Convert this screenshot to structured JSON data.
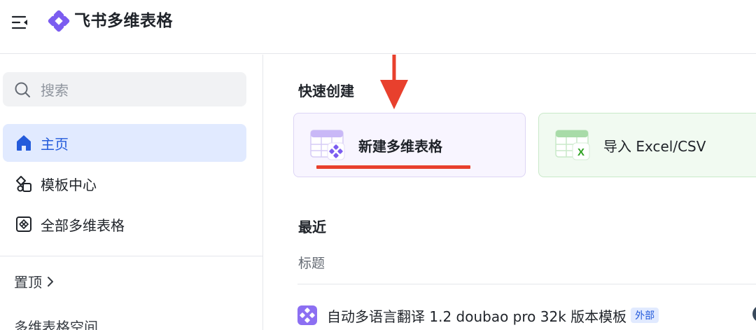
{
  "header": {
    "app_title": "飞书多维表格",
    "collapse_icon": "sidebar-collapse-icon",
    "logo_icon": "bitable-logo-icon",
    "brand_color": "#7b5cf0"
  },
  "sidebar": {
    "search_placeholder": "搜索",
    "items": [
      {
        "label": "主页",
        "icon": "home-icon",
        "active": true
      },
      {
        "label": "模板中心",
        "icon": "template-icon",
        "active": false
      },
      {
        "label": "全部多维表格",
        "icon": "all-bitable-icon",
        "active": false
      }
    ],
    "pinned_label": "置顶",
    "space_label": "多维表格空间"
  },
  "main": {
    "quick_create_title": "快速创建",
    "cards": [
      {
        "label": "新建多维表格",
        "icon": "new-bitable-icon"
      },
      {
        "label": "导入 Excel/CSV",
        "icon": "import-excel-icon"
      }
    ],
    "recent_title": "最近",
    "columns": [
      "标题"
    ],
    "rows": [
      {
        "title": "自动多语言翻译 1.2 doubao pro 32k 版本模板",
        "badge": "外部"
      }
    ]
  },
  "colors": {
    "active_bg": "#e1eaff",
    "active_text": "#245bdb",
    "annotation_red": "#e8402d"
  }
}
